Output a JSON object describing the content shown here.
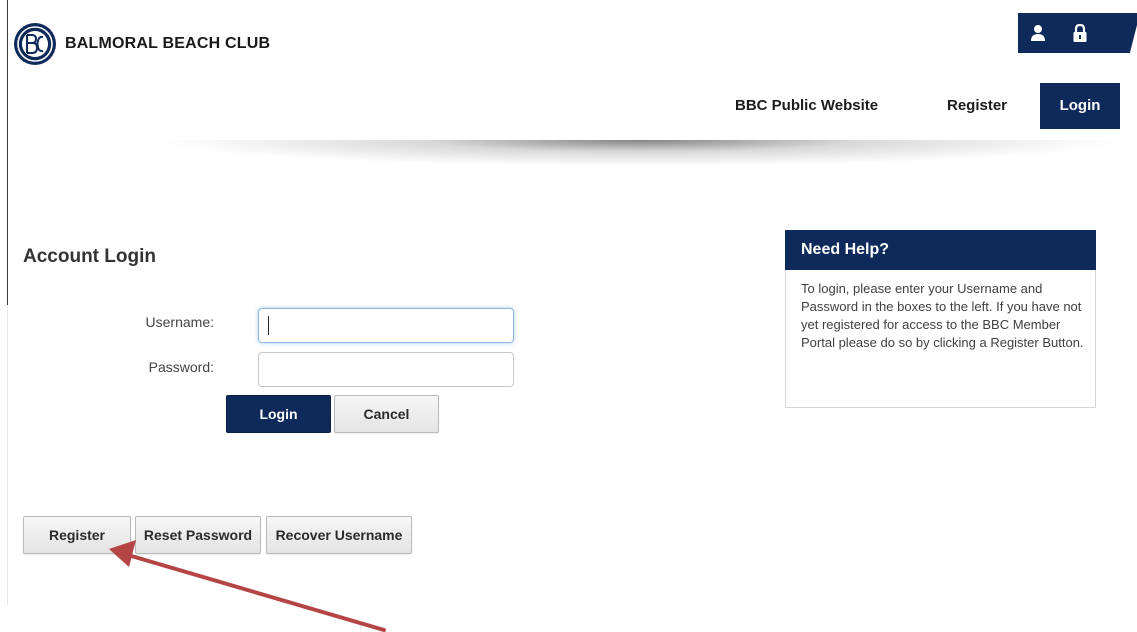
{
  "header": {
    "club_name": "BALMORAL BEACH CLUB",
    "logo_icon": "bbc-monogram-logo",
    "utility_icons": [
      "user-icon",
      "lock-icon"
    ]
  },
  "nav": {
    "public_website": "BBC Public Website",
    "register": "Register",
    "login": "Login"
  },
  "login": {
    "title": "Account Login",
    "username_label": "Username:",
    "password_label": "Password:",
    "username_value": "",
    "password_value": "",
    "login_button": "Login",
    "cancel_button": "Cancel"
  },
  "account_actions": {
    "register": "Register",
    "reset_password": "Reset Password",
    "recover_username": "Recover Username"
  },
  "help": {
    "title": "Need Help?",
    "text": "To login, please enter your Username and Password in the boxes to the left. If you have not yet registered for access to the BBC Member Portal please do so by clicking a Register Button."
  },
  "colors": {
    "brand_navy": "#0e2a5b",
    "annotation_arrow": "#b54545"
  }
}
